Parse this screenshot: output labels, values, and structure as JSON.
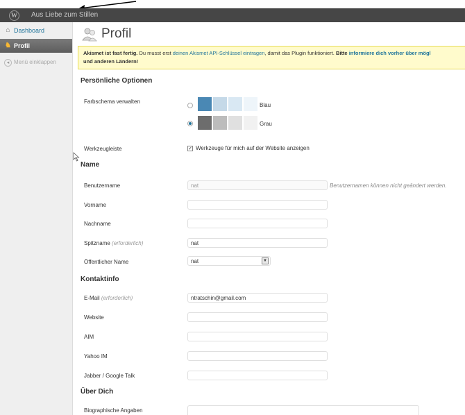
{
  "adminbar": {
    "site_title": "Aus Liebe zum Stillen"
  },
  "sidebar": {
    "items": [
      {
        "label": "Dashboard",
        "icon": "home-icon"
      },
      {
        "label": "Profil",
        "icon": "user-icon"
      },
      {
        "label": "Menü einklappen",
        "icon": "collapse-icon"
      }
    ]
  },
  "page": {
    "title": "Profil"
  },
  "notice": {
    "bold_lead": "Akismet ist fast fertig.",
    "text_1": " Du musst erst ",
    "link_1": "deinen Akismet API-Schlüssel eintragen",
    "text_2": ", damit das Plugin funktioniert. ",
    "bold_2": "Bitte",
    "link_2": "informiere dich vorher über mögl",
    "line_2": "und anderen Ländern!"
  },
  "sections": {
    "personal": "Persönliche Optionen",
    "name": "Name",
    "contact": "Kontaktinfo",
    "about": "Über Dich"
  },
  "personal": {
    "color_scheme_label": "Farbschema verwalten",
    "schemes": [
      {
        "name": "Blau",
        "selected": false,
        "colors": [
          "#4a88b4",
          "#c5d9e8",
          "#d9e8f3",
          "#eef5fa"
        ]
      },
      {
        "name": "Grau",
        "selected": true,
        "colors": [
          "#6d6d6d",
          "#bcbcbc",
          "#e0e0e0",
          "#f1f1f1"
        ]
      }
    ],
    "toolbar_label": "Werkzeugleiste",
    "toolbar_checkbox": "Werkzeuge für mich auf der Website anzeigen",
    "toolbar_checked": true
  },
  "name": {
    "username_label": "Benutzername",
    "username_value": "nat",
    "username_desc": "Benutzernamen können nicht geändert werden.",
    "firstname_label": "Vorname",
    "lastname_label": "Nachname",
    "nickname_label": "Spitzname",
    "nickname_required": "(erforderlich)",
    "nickname_value": "nat",
    "display_label": "Öffentlicher Name",
    "display_value": "nat"
  },
  "contact": {
    "email_label": "E-Mail",
    "email_required": "(erforderlich)",
    "email_value": "ntratschin@gmail.com",
    "website_label": "Website",
    "aim_label": "AIM",
    "yahoo_label": "Yahoo IM",
    "jabber_label": "Jabber / Google Talk"
  },
  "about": {
    "bio_label": "Biographische Angaben"
  }
}
